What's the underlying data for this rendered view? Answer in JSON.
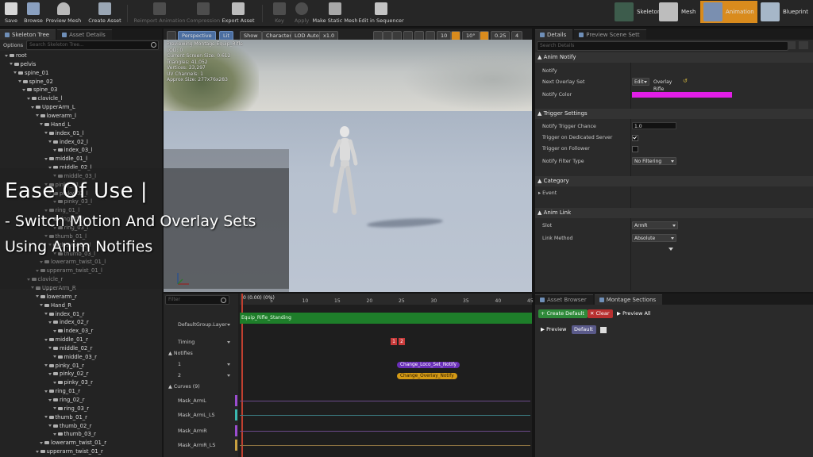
{
  "toolbar": {
    "buttons": [
      {
        "label": "Save",
        "enabled": true
      },
      {
        "label": "Browse",
        "enabled": true
      },
      {
        "label": "Preview Mesh",
        "enabled": true
      },
      {
        "label": "Create Asset",
        "enabled": true
      },
      {
        "label": "Reimport Animation",
        "enabled": false
      },
      {
        "label": "Compression",
        "enabled": false
      },
      {
        "label": "Export Asset",
        "enabled": true
      },
      {
        "label": "Key",
        "enabled": false
      },
      {
        "label": "Apply",
        "enabled": false
      },
      {
        "label": "Make Static Mesh",
        "enabled": true
      },
      {
        "label": "Edit in Sequencer",
        "enabled": true
      }
    ],
    "modes": [
      {
        "label": "Skeleton",
        "active": false
      },
      {
        "label": "Mesh",
        "active": false
      },
      {
        "label": "Animation",
        "active": true
      },
      {
        "label": "Blueprint",
        "active": false
      }
    ]
  },
  "skeleton_panel": {
    "tabs": [
      "Skeleton Tree",
      "Asset Details"
    ],
    "options_label": "Options",
    "search_placeholder": "Search Skeleton Tree...",
    "bones": [
      "root",
      "pelvis",
      "spine_01",
      "spine_02",
      "spine_03",
      "clavicle_l",
      "UpperArm_L",
      "lowerarm_l",
      "Hand_L",
      "index_01_l",
      "index_02_l",
      "index_03_l",
      "middle_01_l",
      "middle_02_l",
      "middle_03_l",
      "pinky_01_l",
      "pinky_02_l",
      "pinky_03_l",
      "ring_01_l",
      "ring_02_l",
      "ring_03_l",
      "thumb_01_l",
      "thumb_02_l",
      "thumb_03_l",
      "lowerarm_twist_01_l",
      "upperarm_twist_01_l",
      "clavicle_r",
      "UpperArm_R",
      "lowerarm_r",
      "Hand_R",
      "index_01_r",
      "index_02_r",
      "index_03_r",
      "middle_01_r",
      "middle_02_r",
      "middle_03_r",
      "pinky_01_r",
      "pinky_02_r",
      "pinky_03_r",
      "ring_01_r",
      "ring_02_r",
      "ring_03_r",
      "thumb_01_r",
      "thumb_02_r",
      "thumb_03_r",
      "lowerarm_twist_01_r",
      "upperarm_twist_01_r"
    ]
  },
  "viewport": {
    "perspective_label": "Perspective",
    "lit_label": "Lit",
    "show_label": "Show",
    "character_label": "Character",
    "lod_label": "LOD Auto",
    "speed_label": "x1.0",
    "grid_snap": "10",
    "rotation_snap": "10°",
    "scale_snap": "0.25",
    "camera_speed": "4",
    "info_lines": [
      "Previewing Montage Equip_Rifle",
      "LOD: 0",
      "Current Screen Size: 0.612",
      "Triangles: 41,052",
      "Vertices: 23,297",
      "UV Channels: 1",
      "Approx Size: 277x76x283"
    ]
  },
  "title_overlay": {
    "line1": "Ease Of Use |",
    "line2": "- Switch Motion And Overlay Sets",
    "line3": "Using Anim Notifies"
  },
  "details_panel": {
    "tabs": [
      "Details",
      "Preview Scene Sett"
    ],
    "search_placeholder": "Search Details",
    "anim_notify": {
      "header": "Anim Notify",
      "notify_label": "Notify",
      "next_overlay_set_label": "Next Overlay Set",
      "edit_label": "Edit",
      "overlay_value": "Overlay Rifle",
      "notify_color_label": "Notify Color",
      "notify_color": "#e11ee6"
    },
    "trigger_settings": {
      "header": "Trigger Settings",
      "chance_label": "Notify Trigger Chance",
      "chance_value": "1.0",
      "dedicated_label": "Trigger on Dedicated Server",
      "dedicated_checked": true,
      "follower_label": "Trigger on Follower",
      "follower_checked": false,
      "filter_label": "Notify Filter Type",
      "filter_value": "No Filtering"
    },
    "category": {
      "header": "Category",
      "event_label": "Event"
    },
    "anim_link": {
      "header": "Anim Link",
      "slot_label": "Slot",
      "slot_value": "ArmR",
      "method_label": "Link Method",
      "method_value": "Absolute"
    }
  },
  "timeline": {
    "filter_placeholder": "Filter",
    "current_time": "0 (0.00) (0%)",
    "ticks": [
      "5",
      "10",
      "15",
      "20",
      "25",
      "30",
      "35",
      "40",
      "45"
    ],
    "rows": {
      "slot_label": "DefaultGroup.Layer",
      "section_name": "Equip_Rifle_Standing",
      "timing_label": "Timing",
      "timing_markers": [
        "1",
        "2"
      ],
      "notifies_label": "Notifies",
      "track1": "1",
      "track2": "2",
      "notify1": "Change_Loco_Set_Notify",
      "notify2": "Change_Overlay_Notify",
      "curves_label": "Curves",
      "curves_count": "(9)",
      "curves": [
        "Mask_ArmL",
        "Mask_ArmL_LS",
        "Mask_ArmR",
        "Mask_ArmR_LS"
      ]
    }
  },
  "asset_panel": {
    "tabs": [
      "Asset Browser",
      "Montage Sections"
    ],
    "create_default": "Create Default",
    "clear": "Clear",
    "preview_all": "Preview All",
    "preview": "Preview",
    "default": "Default"
  }
}
